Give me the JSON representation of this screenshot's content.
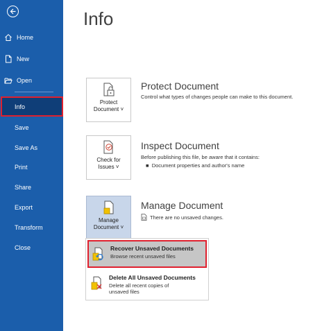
{
  "sidebar": {
    "items": [
      {
        "label": "Home",
        "icon": "home-icon"
      },
      {
        "label": "New",
        "icon": "new-document-icon"
      },
      {
        "label": "Open",
        "icon": "folder-open-icon"
      },
      {
        "label": "Info"
      },
      {
        "label": "Save"
      },
      {
        "label": "Save As"
      },
      {
        "label": "Print"
      },
      {
        "label": "Share"
      },
      {
        "label": "Export"
      },
      {
        "label": "Transform"
      },
      {
        "label": "Close"
      }
    ]
  },
  "main": {
    "title": "Info",
    "sections": [
      {
        "tile_label_1": "Protect",
        "tile_label_2": "Document ˅",
        "title": "Protect Document",
        "description": "Control what types of changes people can make to this document."
      },
      {
        "tile_label_1": "Check for",
        "tile_label_2": "Issues ˅",
        "title": "Inspect Document",
        "description": "Before publishing this file, be aware that it contains:",
        "bullets": [
          "Document properties and author's name"
        ]
      },
      {
        "tile_label_1": "Manage",
        "tile_label_2": "Document ˅",
        "title": "Manage Document",
        "description": "There are no unsaved changes."
      }
    ],
    "dropdown": [
      {
        "title": "Recover Unsaved Documents",
        "subtitle": "Browse recent unsaved files"
      },
      {
        "title": "Delete All Unsaved Documents",
        "subtitle_1": "Delete all recent copies of",
        "subtitle_2": "unsaved files"
      }
    ]
  },
  "colors": {
    "sidebar_bg": "#1b5eab",
    "selected_bg": "#0f3e78",
    "highlight_border": "#e0202e"
  }
}
